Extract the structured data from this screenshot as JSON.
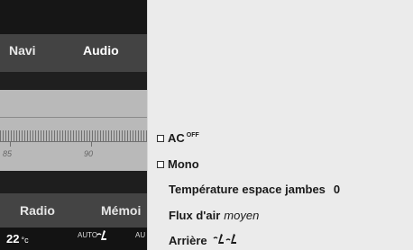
{
  "display": {
    "nav_tabs": [
      {
        "label": "Navi"
      },
      {
        "label": "Audio"
      }
    ],
    "frequency_scale": [
      "85",
      "90"
    ],
    "bottom_tabs": [
      {
        "label": "Radio"
      },
      {
        "label": "Mémoi"
      }
    ],
    "status": {
      "temperature": "22",
      "temperature_unit": "°c",
      "auto_label_1": "AUTO",
      "auto_label_2": "AU"
    }
  },
  "menu": {
    "ac": {
      "label": "AC",
      "superscript": "OFF",
      "checked": false
    },
    "mono": {
      "label": "Mono",
      "checked": false
    },
    "legroom_temp": {
      "label": "Température espace jambes",
      "value": "0"
    },
    "airflow": {
      "label": "Flux d'air",
      "value": "moyen"
    },
    "rear": {
      "label": "Arrière",
      "icons": [
        "seat-airflow-icon",
        "seat-airflow-icon"
      ]
    }
  },
  "colors": {
    "panel_background": "#ebebeb",
    "display_dark": "#1b1b1b",
    "display_bar": "#434343",
    "display_grey": "#b9b9b9"
  }
}
